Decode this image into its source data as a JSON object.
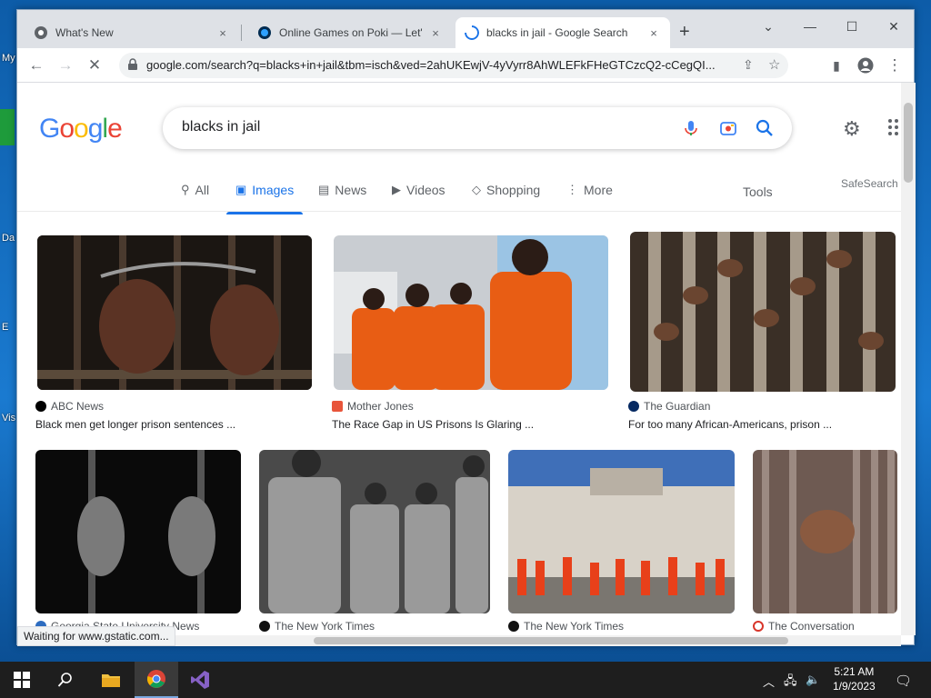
{
  "desktop": {
    "labels": [
      "My",
      "Da",
      "E",
      "Vis"
    ]
  },
  "tabs": [
    {
      "label": "What's New",
      "close": "×"
    },
    {
      "label": "Online Games on Poki — Let's pl",
      "close": "×"
    },
    {
      "label": "blacks in jail - Google Search",
      "close": "×"
    }
  ],
  "new_tab": "+",
  "window_controls": {
    "list": "⌄",
    "minimize": "—",
    "maximize": "☐",
    "close": "✕"
  },
  "toolbar": {
    "url": "google.com/search?q=blacks+in+jail&tbm=isch&ved=2ahUKEwjV-4yVyrr8AhWLEFkFHeGTCzcQ2-cCegQI..."
  },
  "search": {
    "query": "blacks in jail"
  },
  "nav_tabs": [
    {
      "label": "All",
      "icon": "search-icon"
    },
    {
      "label": "Images",
      "icon": "image-icon"
    },
    {
      "label": "News",
      "icon": "news-icon"
    },
    {
      "label": "Videos",
      "icon": "video-icon"
    },
    {
      "label": "Shopping",
      "icon": "tag-icon"
    },
    {
      "label": "More",
      "icon": "more-icon"
    }
  ],
  "tools_label": "Tools",
  "safesearch_label": "SafeSearch",
  "results": [
    {
      "source": "ABC News",
      "title": "Black men get longer prison sentences ...",
      "src_color": "#000000"
    },
    {
      "source": "Mother Jones",
      "title": "The Race Gap in US Prisons Is Glaring ...",
      "src_color": "#e8553b"
    },
    {
      "source": "The Guardian",
      "title": "For too many African-Americans, prison ...",
      "src_color": "#052962"
    },
    {
      "source": "Georgia State University News",
      "title": "",
      "src_color": "#2d6cc0"
    },
    {
      "source": "The New York Times",
      "title": "",
      "src_color": "#111111"
    },
    {
      "source": "The New York Times",
      "title": "",
      "src_color": "#111111"
    },
    {
      "source": "The Conversation",
      "title": "",
      "src_color": "#d8352a"
    }
  ],
  "status_text": "Waiting for www.gstatic.com...",
  "clock": {
    "time": "5:21 AM",
    "date": "1/9/2023"
  },
  "colors": {
    "accent": "#1a73e8",
    "taskbar": "#1e1e1e"
  }
}
